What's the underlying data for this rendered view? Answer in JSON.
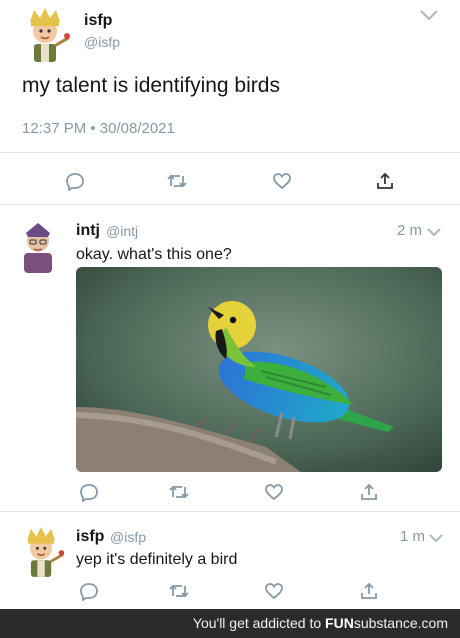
{
  "main_tweet": {
    "name": "isfp",
    "handle": "@isfp",
    "text": "my talent is identifying birds",
    "timestamp": "12:37 PM • 30/08/2021"
  },
  "reply1": {
    "name": "intj",
    "handle": "@intj",
    "time": "2 m",
    "text": "okay. what's this one?"
  },
  "reply2": {
    "name": "isfp",
    "handle": "@isfp",
    "time": "1 m",
    "text": "yep it's definitely a bird"
  },
  "footer": {
    "prefix": "You'll get addicted to",
    "brand_fun": "FUN",
    "brand_rest": "substance.com"
  },
  "icons": [
    "reply-icon",
    "retweet-icon",
    "like-icon",
    "share-icon",
    "chevron-down-icon"
  ],
  "colors": {
    "icon_gray": "#8899a6",
    "text": "#14171a",
    "divider": "#e1e8ed",
    "footer_bg": "#2b2b2b"
  }
}
